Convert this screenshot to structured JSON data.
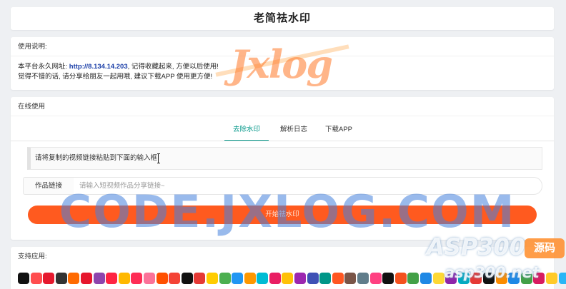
{
  "header": {
    "title": "老简祛水印"
  },
  "notice": {
    "heading": "使用说明:",
    "line1_prefix": "本平台永久网址: ",
    "url": "http://8.134.14.203",
    "line1_suffix": ", 记得收藏起来, 方便以后使用!",
    "line2": "觉得不错的话, 请分享给朋友一起用哦, 建议下载APP 使用更方便!"
  },
  "online": {
    "heading": "在线使用",
    "tabs": [
      {
        "label": "去除水印",
        "active": true
      },
      {
        "label": "解析日志",
        "active": false
      },
      {
        "label": "下载APP",
        "active": false
      }
    ],
    "hint": "请将复制的视频链接粘贴到下面的输入框",
    "field_label": "作品链接",
    "field_placeholder": "请输入短视频作品分享链接~",
    "field_value": "",
    "start_button": "开始祛水印"
  },
  "support": {
    "heading": "支持应用:",
    "apps": [
      {
        "icon": "douyin-icon",
        "color": "#111111"
      },
      {
        "icon": "app-icon",
        "color": "#ff4d4f"
      },
      {
        "icon": "app-icon",
        "color": "#e6192e"
      },
      {
        "icon": "app-icon",
        "color": "#333333"
      },
      {
        "icon": "app-icon",
        "color": "#ff6a00"
      },
      {
        "icon": "app-icon",
        "color": "#e6162d"
      },
      {
        "icon": "app-icon",
        "color": "#8e44ad"
      },
      {
        "icon": "app-icon",
        "color": "#ff2442"
      },
      {
        "icon": "app-icon",
        "color": "#ffb800"
      },
      {
        "icon": "app-icon",
        "color": "#fe2c55"
      },
      {
        "icon": "app-icon",
        "color": "#fb7299"
      },
      {
        "icon": "app-icon",
        "color": "#ff5000"
      },
      {
        "icon": "app-icon",
        "color": "#f44336"
      },
      {
        "icon": "capcut-icon",
        "color": "#111111"
      },
      {
        "icon": "app-icon",
        "color": "#e53935"
      },
      {
        "icon": "app-icon",
        "color": "#ffcc00"
      },
      {
        "icon": "app-icon",
        "color": "#4caf50"
      },
      {
        "icon": "app-icon",
        "color": "#2196f3"
      },
      {
        "icon": "app-icon",
        "color": "#ff9800"
      },
      {
        "icon": "app-icon",
        "color": "#00bcd4"
      },
      {
        "icon": "app-icon",
        "color": "#e91e63"
      },
      {
        "icon": "app-icon",
        "color": "#ffc107"
      },
      {
        "icon": "app-icon",
        "color": "#9c27b0"
      },
      {
        "icon": "app-icon",
        "color": "#3f51b5"
      },
      {
        "icon": "app-icon",
        "color": "#009688"
      },
      {
        "icon": "app-icon",
        "color": "#ff5722"
      },
      {
        "icon": "app-icon",
        "color": "#795548"
      },
      {
        "icon": "app-icon",
        "color": "#607d8b"
      },
      {
        "icon": "app-icon",
        "color": "#ff4081"
      },
      {
        "icon": "app-icon",
        "color": "#111111"
      },
      {
        "icon": "app-icon",
        "color": "#f4511e"
      },
      {
        "icon": "app-icon",
        "color": "#43a047"
      },
      {
        "icon": "app-icon",
        "color": "#1e88e5"
      },
      {
        "icon": "app-icon",
        "color": "#fdd835"
      },
      {
        "icon": "app-icon",
        "color": "#8e24aa"
      },
      {
        "icon": "app-icon",
        "color": "#00acc1"
      },
      {
        "icon": "app-icon",
        "color": "#e53935"
      },
      {
        "icon": "app-icon",
        "color": "#111111"
      },
      {
        "icon": "app-icon",
        "color": "#fb8c00"
      },
      {
        "icon": "app-icon",
        "color": "#1e88e5"
      },
      {
        "icon": "app-icon",
        "color": "#43a047"
      },
      {
        "icon": "app-icon",
        "color": "#d81b60"
      },
      {
        "icon": "app-icon",
        "color": "#ffca28"
      },
      {
        "icon": "app-icon",
        "color": "#29b6f6"
      }
    ]
  },
  "watermarks": {
    "logo": "Jxlog",
    "code": "CODE.JXLOG.COM",
    "asp": "ASP300",
    "yuanma": "源码",
    "asp_url": "asp300.net"
  }
}
